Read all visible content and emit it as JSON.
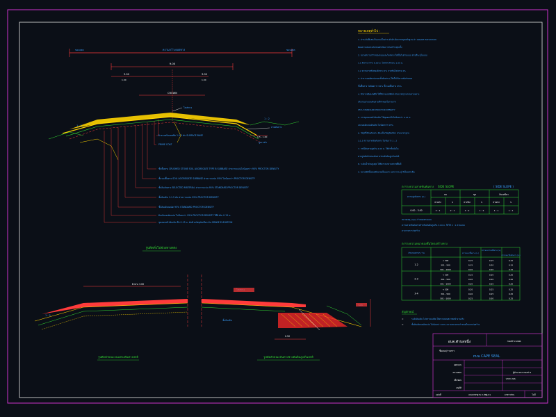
{
  "main_section": {
    "total_width_label": "ความกว้างเขตทาง",
    "sub_width_label": "9.00",
    "lane_left_label": "3.00",
    "lane_right_label": "3.00",
    "crown_label": "CROWN",
    "paved_label": "PAVED SIDE",
    "left_slope_label": "1 : 2",
    "right_slope_label": "1 : 2",
    "top_callout": "ไหล่ทาง",
    "right_callout": "ลาดคันทาง",
    "bottom_dim": "0.5 - 1.00",
    "dim_small": "สูงจากผิว",
    "layer_notes": [
      "ผิวทางชนิดเคพซีล         1:1.5  ทับ SURFACE BASE",
      "PRIME COAT",
      "ชั้นพื้นทาง CRUSHED STONE SOIL AGGREGATE TYPE B SUBBASE  ค่าความแน่นไม่น้อยกว่า  95% PROCTOR DENSITY",
      "ชั้นรองพื้นทาง  SOIL AGGREGATE SUBBASE  ค่าความแน่น  95%  ไม่น้อยกว่า PROCTOR DENSITY",
      "ชั้นดินคันทาง  SELECTED MATERIAL  ค่าความแน่น 95% STANDARD PROCTOR DENSITY",
      "ชั้นดินเดิม  1:1.5  ทับ  ค่าความแน่น 95% PROCTOR DENSITY",
      "ชั้นดินเดิมบดอัด  95% STANDARD PROCTOR DENSITY",
      "ดินเดิมบดอัดแน่น  ไม่น้อยกว่า 95% PROCTOR DENSITY  ใต้ผิวดิน 0.15 ม.",
      "ขุดลอกหน้าดินเดิม  ลึก 0.15 ม. ทับด้วยวัสดุคัดเลือก  ทับ  GRADE ELEVATION"
    ]
  },
  "lower_left": {
    "title": "รูปตัดทั่วไปช่วงทางตรง",
    "left_callout": "1 : 2",
    "top_label": "ผิวทาง 3.00",
    "subtitle": "รูปตัดลักษณะถนนช่วงคันทางปกติ"
  },
  "lower_right": {
    "top_callout": "ไหล่ทาง",
    "bottom_callout": "ชั้นดินเดิม",
    "dim_label": "0.50",
    "subtitle": "รูปตัดลักษณะคันทางช่วงคันดินสูงเกินปกติ"
  },
  "notes": {
    "heading": "หมายเหตุทั่วไป :",
    "lines": [
      "1.  ค่าระดับที่แสดงในแบบเป็นค่าระดับอ้างอิงจากหมุดหลักฐาน ค่า GRADE ELEVATION",
      "    ต้องตรวจสอบระดับก่อนดำเนินการก่อสร้างทุกครั้ง",
      "2.  ขนาดความกว้างของถนนและไหล่ทาง  ให้เป็นไปตามแบบ  ตามที่ระบุในแบบ",
      "    1.1  ผิวทาง  กว้าง 6.00 ม.  ไหล่ทางข้างละ 1.00 ม.",
      "    1.2  ความลาดชันของผิวทาง  2%  ลาดชันไหล่ทาง  4%",
      "3.  ค่าการบดอัดแน่นของชั้นดินต่างๆ  ให้เป็นไปตามข้อกำหนด",
      "    ชั้นพื้นทาง  ไม่น้อยกว่า  95%  ชั้นรองพื้นทาง  95%",
      "4.  ผิวทางชนิดเคพซีล  ให้ใช้ยางแอสฟัลท์  ตามมาตรฐานกรมทางหลวง",
      "    ปริมาณยางและหินตามที่กำหนดในรายการ",
      "    95%  STANDARD PROCTOR DENSITY",
      "5.  การขุดลอกหน้าดินเดิม  ให้ขุดออกลึกไม่น้อยกว่า 0.15 ม.",
      "    และบดอัดแน่นดินเดิม  ไม่น้อยกว่า  95%",
      "6.  วัสดุที่ใช้ถมคันทาง  ต้องเป็นวัสดุคัดเลือก  ตามมาตรฐาน",
      "    1:1.5  ความลาดชันคันทาง  ไม่ชันกว่า 1 : 2",
      "7.  กรณีคันทางสูงเกิน 2.00 ม.  ให้ทำขั้นบันได",
      "    ตามรูปตัดลักษณะคันทางช่วงคันดินสูงเกินปกติ",
      "8.  ระดับน้ำท่วมสูงสุด  ให้พิจารณาตามสภาพพื้นที่",
      "9.  ขนาดมิติทั้งหมดมีหน่วยเป็นเมตร  นอกจากระบุไว้เป็นอย่างอื่น"
    ]
  },
  "slope_table": {
    "heading": "ตารางความลาดชันคันทาง",
    "heading_mid": "SIDE SLOPE",
    "heading_right": "( SIDE SLOPE )",
    "col_height": "ความสูงคันทาง (ม.)",
    "col_fill": "ถม",
    "col_cut": "ขุด",
    "col_other": "ดินเหนียว",
    "sub_cols": [
      "ทางตรง",
      "S",
      "ทางโค้ง",
      "S",
      "ทางตรง",
      "S"
    ],
    "row_label": "0.00 - 3.00",
    "row_values": [
      "2 : 1",
      "2 : 1",
      "1 : 2",
      "1 : 2",
      "1 : 1",
      "1 : 1"
    ],
    "note1": "หมายเหตุ  slope กำหนดตามแบบ",
    "note2": "ความลาดชันคันทางสำหรับคันดินสูงเกิน  3.00  ม.  ให้ใช้  2 : 1  ตามแบบ",
    "note3": "ตามรายการก่อสร้าง"
  },
  "thickness_table": {
    "heading": "ตารางความหนาของชั้นโครงสร้างทาง",
    "col1": "ปริมาณจราจร / วัน",
    "col2": "ความหนาพื้นทาง (ม.)",
    "col3": "ความหนารองพื้นทาง (ม.)",
    "col4": "ความหนาดินคันทาง (ม.)",
    "groups": [
      {
        "label": "1-2",
        "rows": [
          [
            "< 300",
            "0.15",
            "0.15",
            "0.15"
          ],
          [
            "301 - 500",
            "0.15",
            "0.20",
            "0.15"
          ],
          [
            "501 - 1000",
            "0.20",
            "0.20",
            "0.15"
          ]
        ]
      },
      {
        "label": "2-3",
        "rows": [
          [
            "< 300",
            "0.15",
            "0.20",
            "0.20"
          ],
          [
            "301 - 500",
            "0.20",
            "0.20",
            "0.20"
          ],
          [
            "501 - 1000",
            "0.20",
            "0.25",
            "0.20"
          ]
        ]
      },
      {
        "label": "3-4",
        "rows": [
          [
            "< 300",
            "0.20",
            "0.25",
            "0.25"
          ],
          [
            "301 - 500",
            "0.20",
            "0.25",
            "0.25"
          ],
          [
            "501 - 1000",
            "0.25",
            "0.30",
            "0.25"
          ]
        ]
      }
    ]
  },
  "legend": {
    "heading": "สัญลักษณ์",
    "item1": "ระดับดินเดิม  ไม่ทราบแน่ชัด  ให้ตรวจสอบสภาพหน้างานจริง",
    "item2": "ชั้นดินเดิมบดอัดแน่น  ไม่น้อยกว่า  95%  ความหนาตามกำหนดในแบบก่อสร้าง"
  },
  "title_block": {
    "org": "อบต.ตำบลหนึ่ง",
    "org_right": "กองช่าง อบต.",
    "project_label": "ชื่อแบบ/รายการ",
    "project_name": "ถนน CAPE SEAL",
    "row1_label": "ออกแบบ",
    "row2_label": "ตรวจสอบ",
    "row3_label": "เห็นชอบ",
    "row4_label": "อนุมัติ",
    "row1_right": "ผู้อำนวยการกองช่าง",
    "row3_right": "นายก อบต.",
    "sheet_label": "แผ่นที่",
    "sheet_value": "",
    "drawing_no": "แบบมาตรฐาน  ถ.สพฐ.01",
    "scale_label": "มาตราส่วน",
    "scale_value": "ไม่มี"
  },
  "colors": {
    "frame": "#cc33cc",
    "inner": "#f2f2f2",
    "road": "#ffd400",
    "dim": "#ff3b3b",
    "text_green": "#33dd33",
    "text_blue": "#3aa0ff",
    "text_white": "#ffffff",
    "line_cyan": "#00d7ff"
  }
}
